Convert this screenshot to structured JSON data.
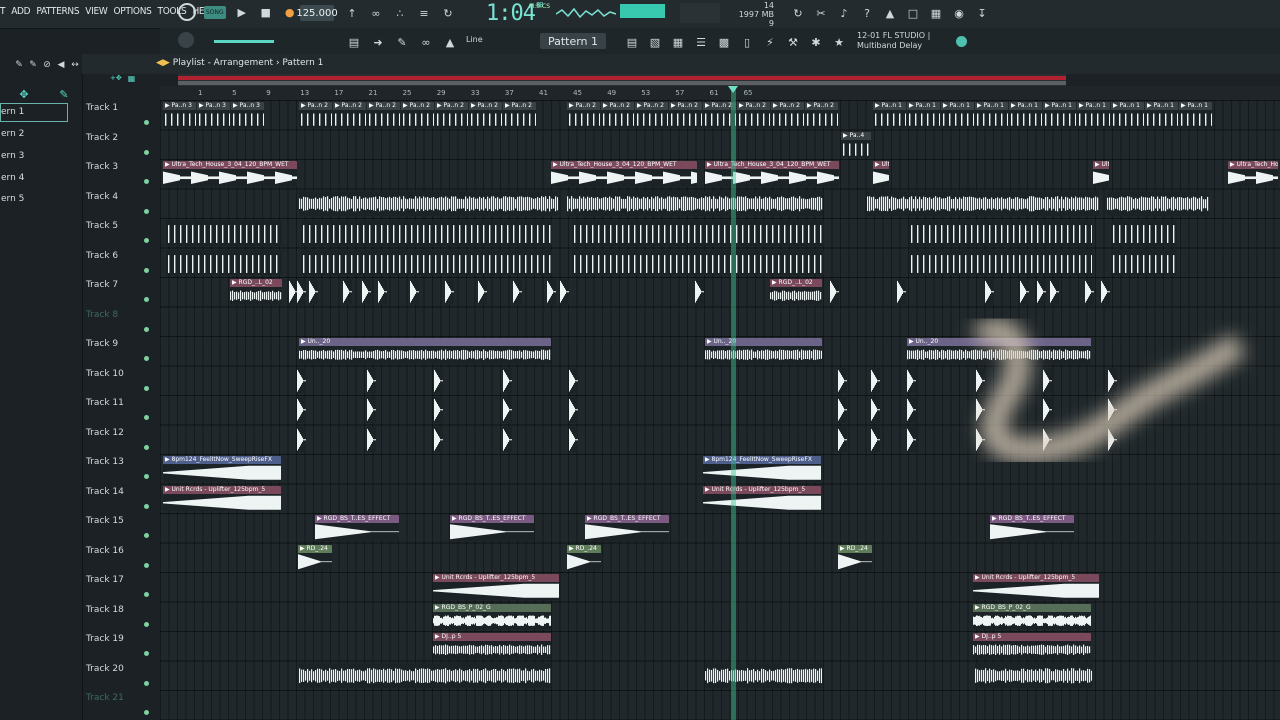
{
  "menu": [
    "T",
    "ADD",
    "PATTERNS",
    "VIEW",
    "OPTIONS",
    "TOOLS",
    "HELP"
  ],
  "transport": {
    "tempo": "125.000",
    "time": "1:04",
    "time_frac": "80",
    "time_unit": "M:S:CS",
    "pat_song": "SONG"
  },
  "cpu": {
    "line1": "14",
    "mem": "1997 MB",
    "line3": "9"
  },
  "toolbar2": {
    "line_mode": "Line",
    "pattern": "Pattern 1",
    "hint_title": "12-01  FL STUDIO |",
    "hint_sub": "Multiband Delay"
  },
  "browser": {
    "patterns": [
      "ern 1",
      "ern 2",
      "ern 3",
      "ern 4",
      "ern 5"
    ]
  },
  "playlist": {
    "breadcrumb": "Playlist - Arrangement › Pattern 1"
  },
  "ruler": {
    "ticks": [
      "1",
      "5",
      "9",
      "13",
      "17",
      "21",
      "25",
      "29",
      "33",
      "37",
      "41",
      "45",
      "49",
      "53",
      "57",
      "61",
      "65"
    ]
  },
  "tracks": [
    "Track 1",
    "Track 2",
    "Track 3",
    "Track 4",
    "Track 5",
    "Track 6",
    "Track 7",
    "Track 8",
    "Track 9",
    "Track 10",
    "Track 11",
    "Track 12",
    "Track 13",
    "Track 14",
    "Track 15",
    "Track 16",
    "Track 17",
    "Track 18",
    "Track 19",
    "Track 20",
    "Track 21"
  ],
  "clip_labels": {
    "pat": "Pa..n 3",
    "pat2": "Pa..n 2",
    "pat1": "Pa..n 1",
    "pa4": "Pa..4",
    "ultra": "Ultra_Tech_House_3_04_120_BPM_WET",
    "rgd": "RGD_..L_02",
    "un": "Un.._20",
    "bpm": "8pm124_FeelItNow_SweepRiseFX",
    "unit": "Unit Rcrds - Uplifter_125bpm_5",
    "effect": "RGD_BS_T..ES_EFFECT",
    "rd": "RD_.24",
    "rgdbs": "RGD_BS_P_02_G",
    "djp": "DJ..p 5"
  },
  "colors": {
    "accent": "#79e4d3",
    "pink": "#8a5a6e",
    "lavender": "#6c6488",
    "green": "#5f7d5a",
    "blue": "#4e5f8c",
    "mauve": "#7a4a5c"
  }
}
